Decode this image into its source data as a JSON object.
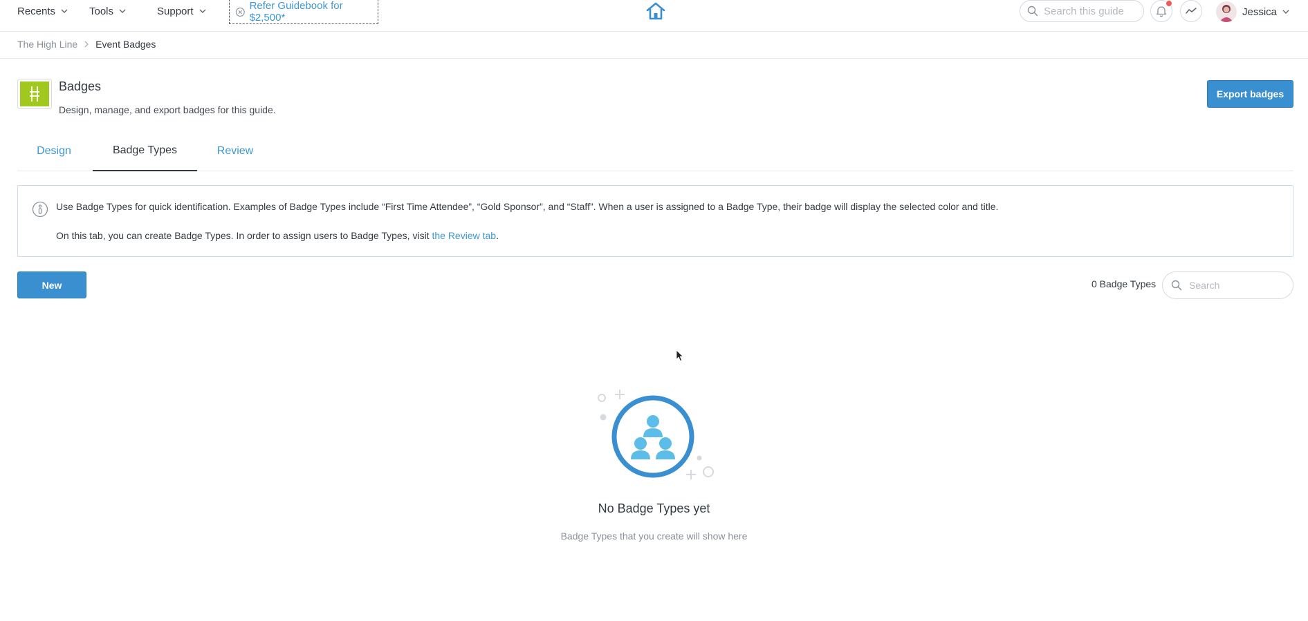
{
  "nav": {
    "recents": "Recents",
    "tools": "Tools",
    "support": "Support",
    "refer": "Refer Guidebook for $2,500*",
    "search_placeholder": "Search this guide",
    "user_name": "Jessica"
  },
  "breadcrumb": {
    "parent": "The High Line",
    "current": "Event Badges"
  },
  "header": {
    "title": "Badges",
    "subtitle": "Design, manage, and export badges for this guide.",
    "export_button": "Export badges"
  },
  "tabs": [
    {
      "label": "Design",
      "active": false
    },
    {
      "label": "Badge Types",
      "active": true
    },
    {
      "label": "Review",
      "active": false
    }
  ],
  "info": {
    "line1": "Use Badge Types for quick identification. Examples of Badge Types include “First Time Attendee”, “Gold Sponsor”, and “Staff”. When a user is assigned to a Badge Type, their badge will display the selected color and title.",
    "line2_prefix": "On this tab, you can create Badge Types. In order to assign users to Badge Types, visit ",
    "line2_link": "the Review tab",
    "line2_suffix": "."
  },
  "toolbar": {
    "new_button": "New",
    "count": "0 Badge Types",
    "search_placeholder": "Search"
  },
  "empty_state": {
    "title": "No Badge Types yet",
    "subtitle": "Badge Types that you create will show here"
  },
  "colors": {
    "accent": "#3a8fd0",
    "link": "#3c97d3",
    "logo_green": "#a0c81e",
    "notification": "#f05a5a"
  }
}
